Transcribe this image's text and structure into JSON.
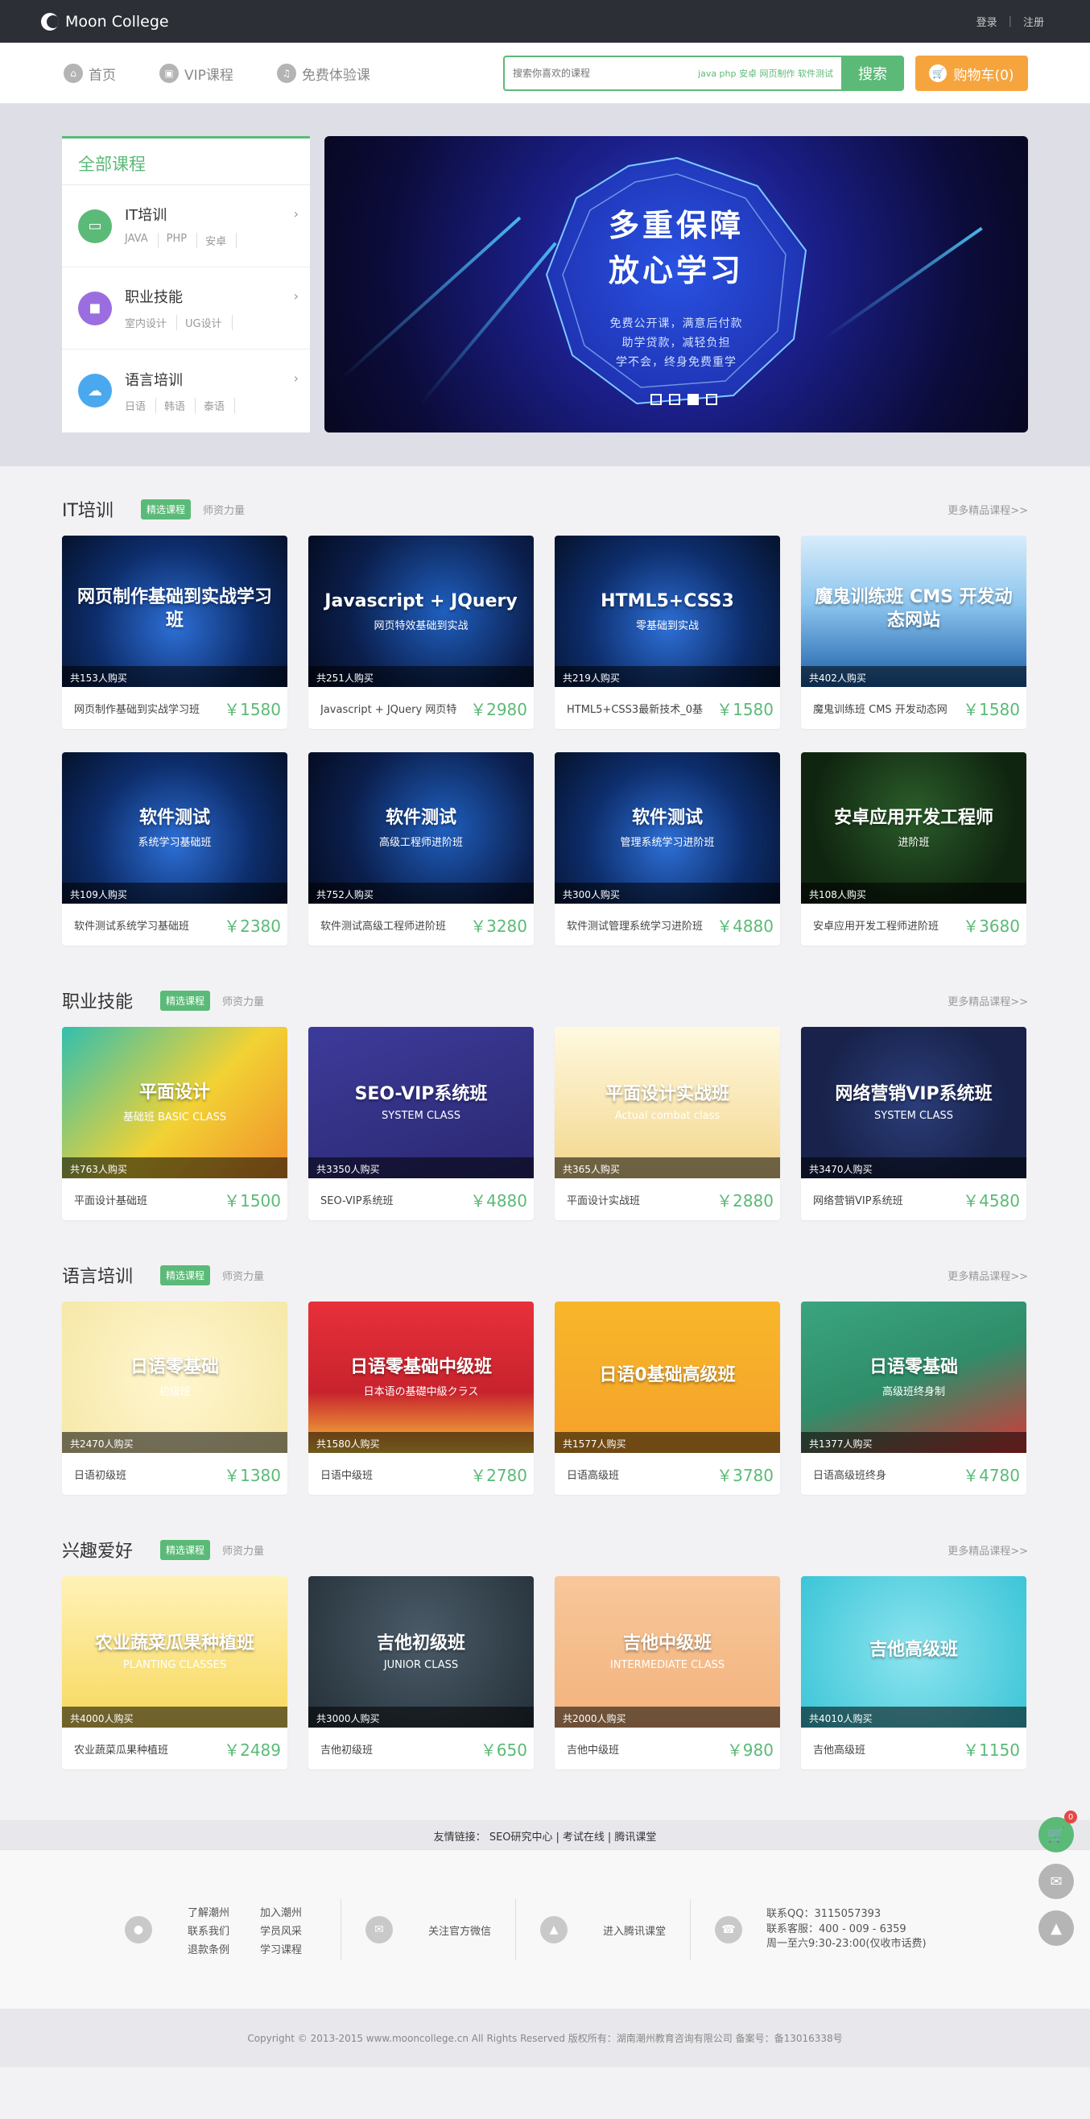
{
  "header": {
    "logo_text": "Moon College",
    "login": "登录",
    "sep": "|",
    "register": "注册"
  },
  "nav": {
    "items": [
      {
        "label": "首页",
        "icon": "home-icon"
      },
      {
        "label": "VIP课程",
        "icon": "vip-icon"
      },
      {
        "label": "免费体验课",
        "icon": "headphone-icon"
      }
    ],
    "search_placeholder": "搜索你喜欢的课程",
    "search_tags": "java php 安卓 网页制作 软件测试",
    "search_button": "搜索",
    "cart_label": "购物车(0)"
  },
  "categories": {
    "title": "全部课程",
    "items": [
      {
        "name": "IT培训",
        "subs": [
          "JAVA",
          "PHP",
          "安卓"
        ],
        "color": "#5bba77",
        "icon": "monitor-icon"
      },
      {
        "name": "职业技能",
        "subs": [
          "室内设计",
          "UG设计"
        ],
        "color": "#9b6ee0",
        "icon": "briefcase-icon"
      },
      {
        "name": "语言培训",
        "subs": [
          "日语",
          "韩语",
          "泰语"
        ],
        "color": "#4aa8ef",
        "icon": "chat-icon"
      }
    ]
  },
  "banner": {
    "line1": "多重保障",
    "line2": "放心学习",
    "sub1": "免费公开课，满意后付款",
    "sub2": "助学贷款，减轻负担",
    "sub3": "学不会，终身免费重学",
    "active_slide": 3,
    "slides": 4
  },
  "sections": [
    {
      "title": "IT培训",
      "badge": "精选课程",
      "tab": "师资力量",
      "more": "更多精品课程>>",
      "courses": [
        {
          "thumb": "网页制作基础到实战学习班",
          "thumb_sub": "",
          "buyers": "共153人购买",
          "name": "网页制作基础到实战学习班",
          "price": "￥1580",
          "style": "th-it"
        },
        {
          "thumb": "Javascript + JQuery",
          "thumb_sub": "网页特效基础到实战",
          "buyers": "共251人购买",
          "name": "Javascript + JQuery 网页特",
          "price": "￥2980",
          "style": "th-dark"
        },
        {
          "thumb": "HTML5+CSS3",
          "thumb_sub": "零基础到实战",
          "buyers": "共219人购买",
          "name": "HTML5+CSS3最新技术_0基",
          "price": "￥1580",
          "style": "th-it"
        },
        {
          "thumb": "魔鬼训练班 CMS 开发动态网站",
          "thumb_sub": "",
          "buyers": "共402人购买",
          "name": "魔鬼训练班 CMS 开发动态网",
          "price": "￥1580",
          "style": "th-sky"
        },
        {
          "thumb": "软件测试",
          "thumb_sub": "系统学习基础班",
          "buyers": "共109人购买",
          "name": "软件测试系统学习基础班",
          "price": "￥2380",
          "style": "th-it"
        },
        {
          "thumb": "软件测试",
          "thumb_sub": "高级工程师进阶班",
          "buyers": "共752人购买",
          "name": "软件测试高级工程师进阶班",
          "price": "￥3280",
          "style": "th-dark"
        },
        {
          "thumb": "软件测试",
          "thumb_sub": "管理系统学习进阶班",
          "buyers": "共300人购买",
          "name": "软件测试管理系统学习进阶班",
          "price": "￥4880",
          "style": "th-it"
        },
        {
          "thumb": "安卓应用开发工程师",
          "thumb_sub": "进阶班",
          "buyers": "共108人购买",
          "name": "安卓应用开发工程师进阶班",
          "price": "￥3680",
          "style": "th-green"
        }
      ]
    },
    {
      "title": "职业技能",
      "badge": "精选课程",
      "tab": "师资力量",
      "more": "更多精品课程>>",
      "courses": [
        {
          "thumb": "平面设计",
          "thumb_sub": "基础班 BASIC CLASS",
          "buyers": "共763人购买",
          "name": "平面设计基础班",
          "price": "￥1500",
          "style": "th-teal"
        },
        {
          "thumb": "SEO-VIP系统班",
          "thumb_sub": "SYSTEM CLASS",
          "buyers": "共3350人购买",
          "name": "SEO-VIP系统班",
          "price": "￥4880",
          "style": "th-purple"
        },
        {
          "thumb": "平面设计实战班",
          "thumb_sub": "Actual combat class",
          "buyers": "共365人购买",
          "name": "平面设计实战班",
          "price": "￥2880",
          "style": "th-cream"
        },
        {
          "thumb": "网络营销VIP系统班",
          "thumb_sub": "SYSTEM CLASS",
          "buyers": "共3470人购买",
          "name": "网络营销VIP系统班",
          "price": "￥4580",
          "style": "th-navy"
        }
      ]
    },
    {
      "title": "语言培训",
      "badge": "精选课程",
      "tab": "师资力量",
      "more": "更多精品课程>>",
      "courses": [
        {
          "thumb": "日语零基础",
          "thumb_sub": "初级班",
          "buyers": "共2470人购买",
          "name": "日语初级班",
          "price": "￥1380",
          "style": "th-lightyellow"
        },
        {
          "thumb": "日语零基础中级班",
          "thumb_sub": "日本语の基礎中級クラス",
          "buyers": "共1580人购买",
          "name": "日语中级班",
          "price": "￥2780",
          "style": "th-red"
        },
        {
          "thumb": "日语0基础高级班",
          "thumb_sub": "",
          "buyers": "共1577人购买",
          "name": "日语高级班",
          "price": "￥3780",
          "style": "th-chalk"
        },
        {
          "thumb": "日语零基础",
          "thumb_sub": "高级班终身制",
          "buyers": "共1377人购买",
          "name": "日语高级班终身",
          "price": "￥4780",
          "style": "th-redgreen"
        }
      ]
    },
    {
      "title": "兴趣爱好",
      "badge": "精选课程",
      "tab": "师资力量",
      "more": "更多精品课程>>",
      "courses": [
        {
          "thumb": "农业蔬菜瓜果种植班",
          "thumb_sub": "PLANTING CLASSES",
          "buyers": "共4000人购买",
          "name": "农业蔬菜瓜果种植班",
          "price": "￥2489",
          "style": "th-veg"
        },
        {
          "thumb": "吉他初级班",
          "thumb_sub": "JUNIOR CLASS",
          "buyers": "共3000人购买",
          "name": "吉他初级班",
          "price": "￥650",
          "style": "th-guitar"
        },
        {
          "thumb": "吉他中级班",
          "thumb_sub": "INTERMEDIATE CLASS",
          "buyers": "共2000人购买",
          "name": "吉他中级班",
          "price": "￥980",
          "style": "th-peach"
        },
        {
          "thumb": "吉他高级班",
          "thumb_sub": "",
          "buyers": "共4010人购买",
          "name": "吉他高级班",
          "price": "￥1150",
          "style": "th-cyan"
        }
      ]
    }
  ],
  "friends": {
    "label": "友情链接：",
    "links": [
      "SEO研究中心",
      "考试在线",
      "腾讯课堂"
    ]
  },
  "footer": {
    "links": [
      "了解潮州",
      "加入潮州",
      "联系我们",
      "学员风采",
      "退款条例",
      "学习课程"
    ],
    "wechat": "关注官方微信",
    "tencent": "进入腾讯课堂",
    "qq": "联系QQ：3115057393",
    "phone": "联系客服：400 - 009 - 6359",
    "hours": "周一至六9:30-23:00(仅收市话费)",
    "copyright": "Copyright © 2013-2015 www.mooncollege.cn All Rights Reserved 版权所有：湖南潮州教育咨询有限公司 备案号：备13016338号"
  },
  "floating": {
    "cart_count": "0"
  }
}
